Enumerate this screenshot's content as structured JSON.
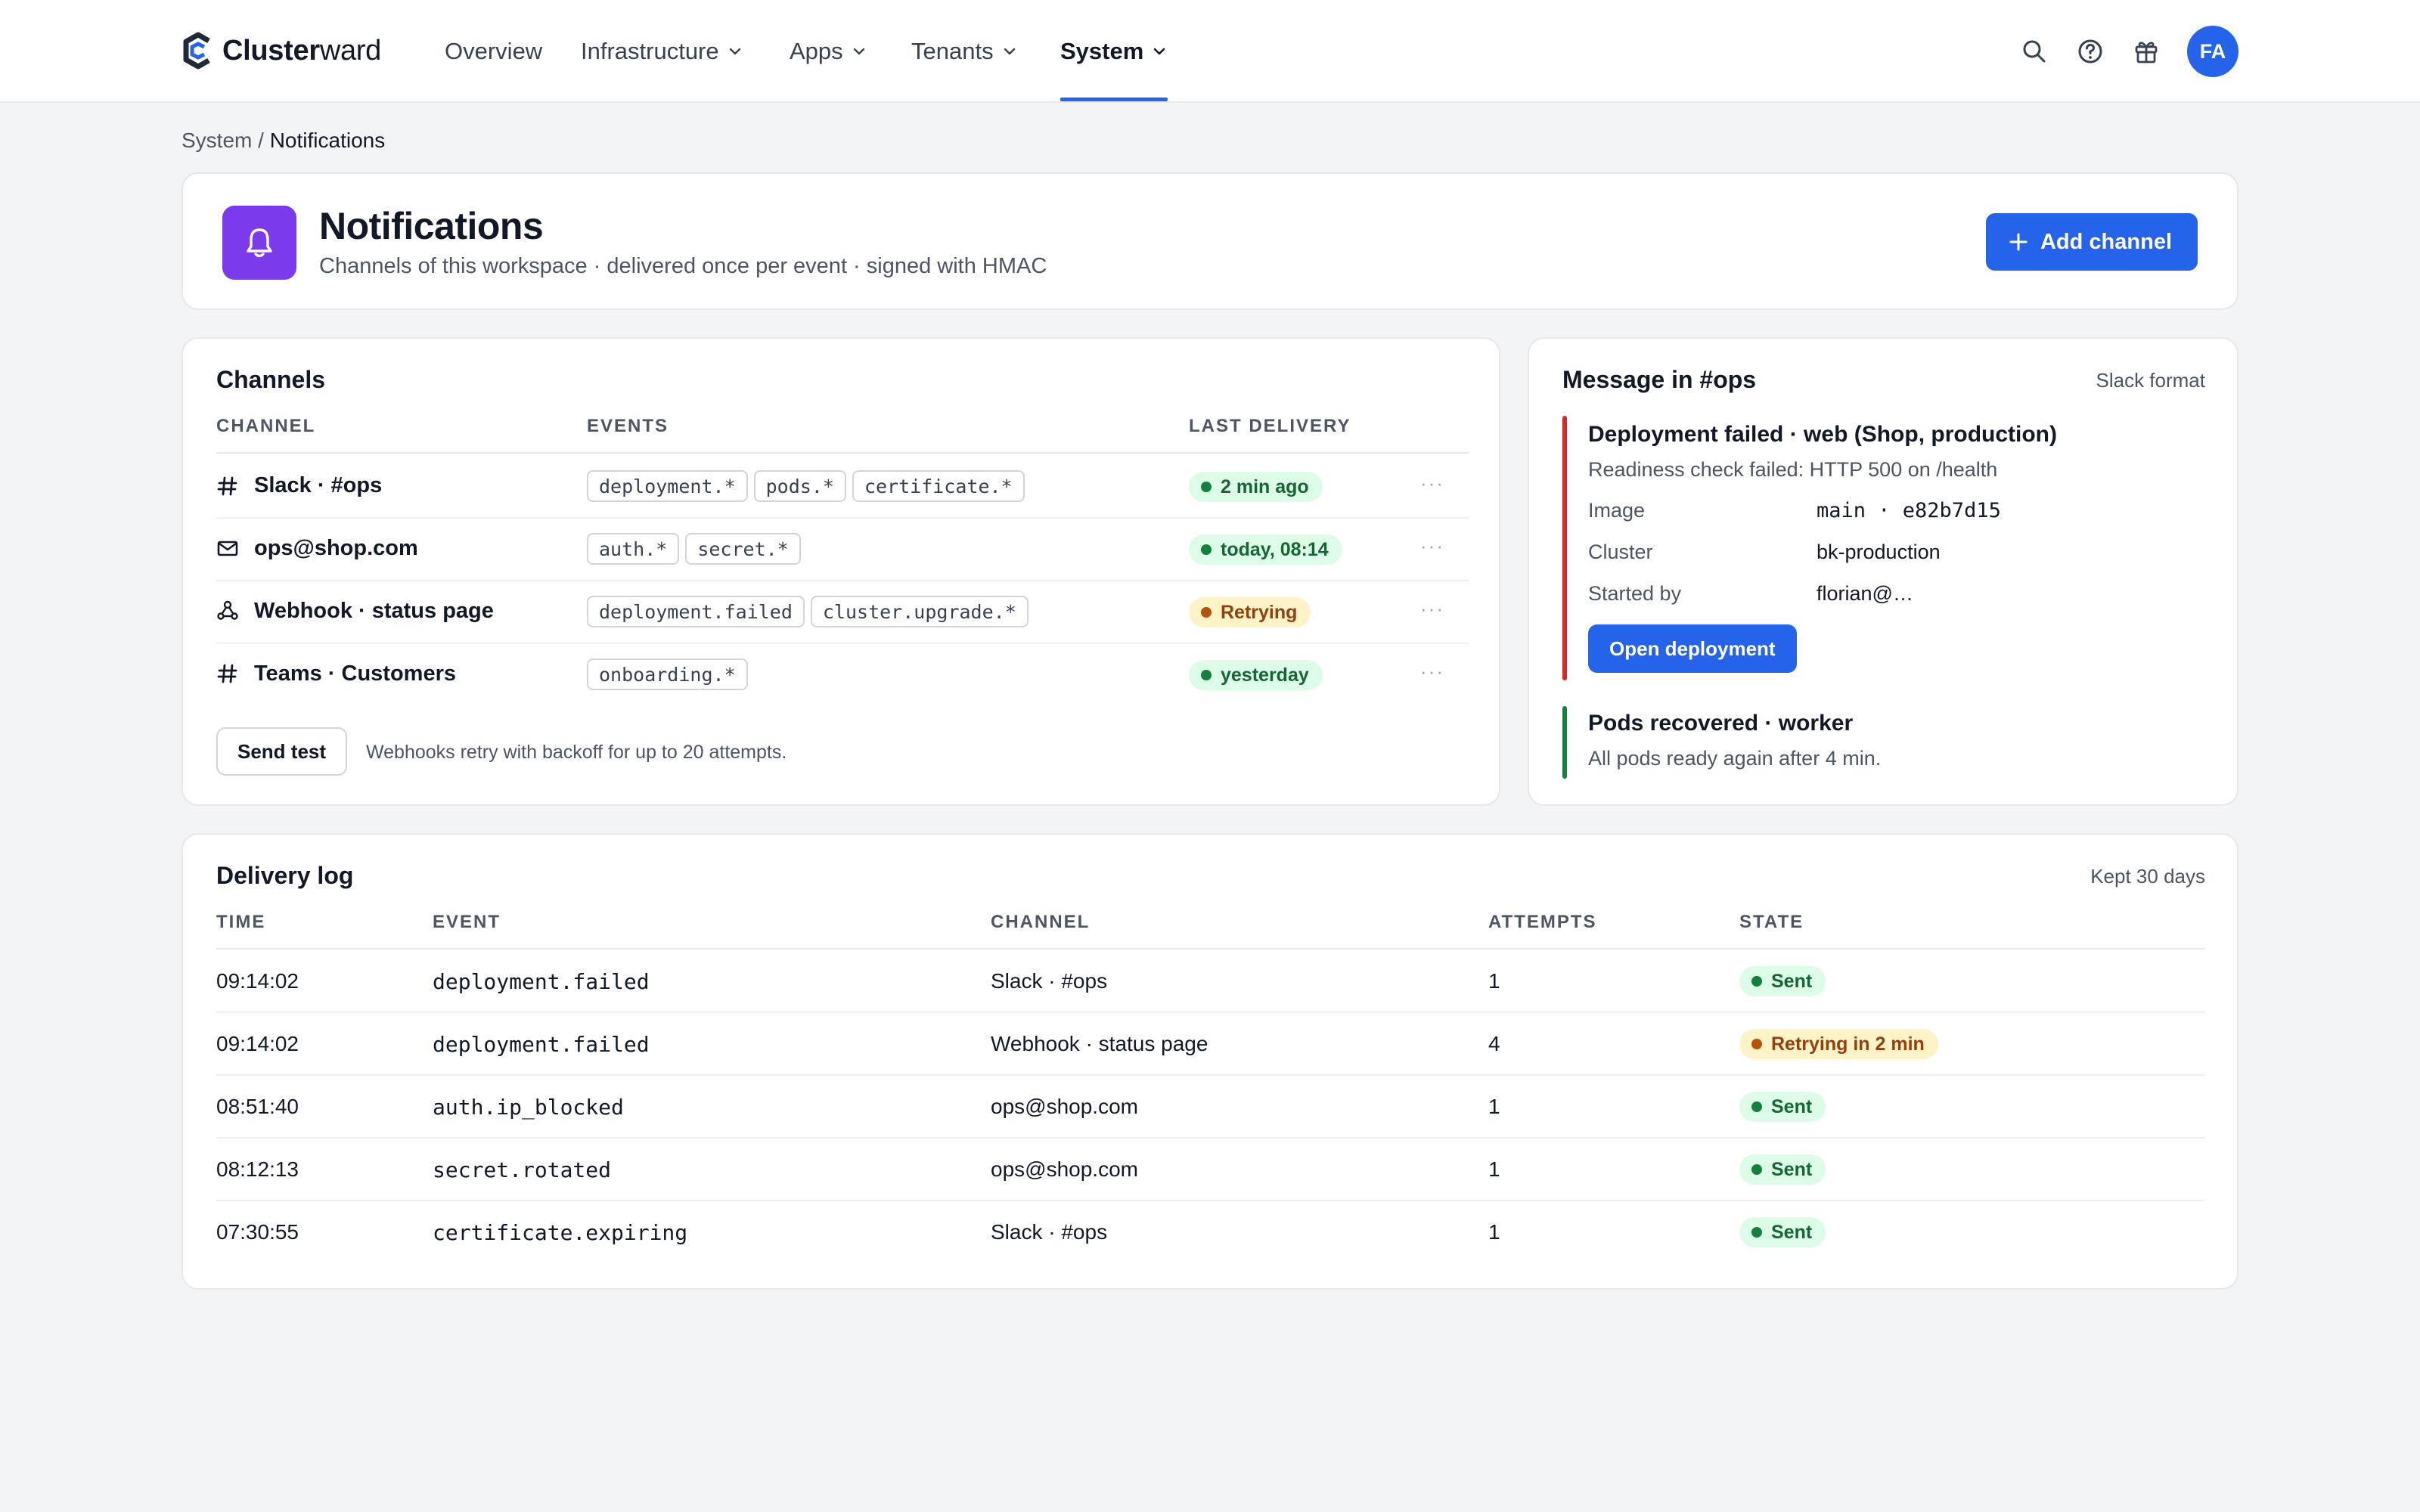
{
  "app": {
    "brand_name": "Clusterward",
    "brand_bold": "Cluster",
    "brand_rest": "ward"
  },
  "nav": {
    "items": [
      {
        "label": "Overview",
        "has_menu": false,
        "active": false
      },
      {
        "label": "Infrastructure",
        "has_menu": true,
        "active": false
      },
      {
        "label": "Apps",
        "has_menu": true,
        "active": false
      },
      {
        "label": "Tenants",
        "has_menu": true,
        "active": false
      },
      {
        "label": "System",
        "has_menu": true,
        "active": true
      }
    ],
    "icons": [
      "search-icon",
      "help-icon",
      "gift-icon"
    ],
    "avatar_initials": "FA"
  },
  "breadcrumb": {
    "parent": "System",
    "separator": " / ",
    "current": "Notifications"
  },
  "header": {
    "title": "Notifications",
    "subtitle": "Channels of this workspace · delivered once per event · signed with HMAC",
    "add_button": "Add channel",
    "icon": "bell-icon"
  },
  "channels": {
    "title": "Channels",
    "columns": [
      "CHANNEL",
      "EVENTS",
      "LAST DELIVERY"
    ],
    "rows": [
      {
        "icon": "hash-icon",
        "name": "Slack · #ops",
        "events": [
          "deployment.*",
          "pods.*",
          "certificate.*"
        ],
        "status": "2 min ago",
        "tone": "ok"
      },
      {
        "icon": "mail-icon",
        "name": "ops@shop.com",
        "events": [
          "auth.*",
          "secret.*"
        ],
        "status": "today, 08:14",
        "tone": "ok"
      },
      {
        "icon": "webhook-icon",
        "name": "Webhook · status page",
        "events": [
          "deployment.failed",
          "cluster.upgrade.*"
        ],
        "status": "Retrying",
        "tone": "warn"
      },
      {
        "icon": "hash-icon",
        "name": "Teams · Customers",
        "events": [
          "onboarding.*"
        ],
        "status": "yesterday",
        "tone": "ok"
      }
    ],
    "more_label": "···",
    "send_test": "Send test",
    "note": "Webhooks retry with backoff for up to 20 attempts."
  },
  "message": {
    "title": "Message in #ops",
    "format": "Slack format",
    "alert": {
      "title": "Deployment failed · web (Shop, production)",
      "subtitle": "Readiness check failed: HTTP 500 on /health",
      "fields": [
        {
          "key": "Image",
          "value": "main · e82b7d15",
          "mono": true
        },
        {
          "key": "Cluster",
          "value": "bk-production",
          "mono": false
        },
        {
          "key": "Started by",
          "value": "florian@…",
          "mono": false
        }
      ],
      "button": "Open deployment",
      "color": "#dc2626"
    },
    "recovery": {
      "title": "Pods recovered · worker",
      "subtitle": "All pods ready again after 4 min.",
      "color": "#15803d"
    }
  },
  "log": {
    "title": "Delivery log",
    "retention": "Kept 30 days",
    "columns": [
      "TIME",
      "EVENT",
      "CHANNEL",
      "ATTEMPTS",
      "STATE"
    ],
    "rows": [
      {
        "time": "09:14:02",
        "event": "deployment.failed",
        "channel": "Slack · #ops",
        "attempts": "1",
        "state": "Sent",
        "tone": "ok"
      },
      {
        "time": "09:14:02",
        "event": "deployment.failed",
        "channel": "Webhook · status page",
        "attempts": "4",
        "state": "Retrying in 2 min",
        "tone": "warn"
      },
      {
        "time": "08:51:40",
        "event": "auth.ip_blocked",
        "channel": "ops@shop.com",
        "attempts": "1",
        "state": "Sent",
        "tone": "ok"
      },
      {
        "time": "08:12:13",
        "event": "secret.rotated",
        "channel": "ops@shop.com",
        "attempts": "1",
        "state": "Sent",
        "tone": "ok"
      },
      {
        "time": "07:30:55",
        "event": "certificate.expiring",
        "channel": "Slack · #ops",
        "attempts": "1",
        "state": "Sent",
        "tone": "ok"
      }
    ]
  },
  "colors": {
    "accent": "#2563eb",
    "header_icon_bg": "#7c3aed",
    "ok": "#15803d",
    "warn": "#b45309",
    "page_bg": "#f3f4f6"
  }
}
